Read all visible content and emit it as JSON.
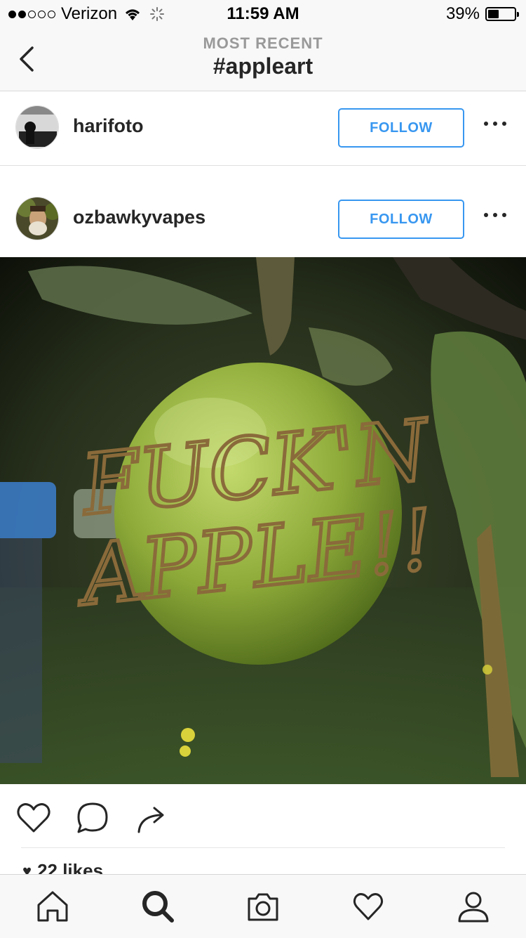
{
  "status_bar": {
    "carrier": "Verizon",
    "time": "11:59 AM",
    "battery": "39%"
  },
  "nav": {
    "subtitle": "MOST RECENT",
    "title": "#appleart"
  },
  "posts": [
    {
      "username": "harifoto",
      "follow_label": "FOLLOW"
    },
    {
      "username": "ozbawkyvapes",
      "follow_label": "FOLLOW"
    }
  ],
  "photo": {
    "carved_text_line1": "FUCK'N",
    "carved_text_line2": "APPLE!!"
  },
  "likes_text": "22 likes",
  "colors": {
    "accent": "#3897f0",
    "text": "#262626",
    "muted": "#999999",
    "bar_bg": "#f8f8f8"
  },
  "icons": {
    "back": "chevron-left-icon",
    "more": "ellipsis-icon",
    "like": "heart-icon",
    "comment": "comment-icon",
    "share": "share-arrow-icon",
    "tabs": [
      "home-icon",
      "search-icon",
      "camera-icon",
      "heart-icon",
      "profile-icon"
    ]
  }
}
